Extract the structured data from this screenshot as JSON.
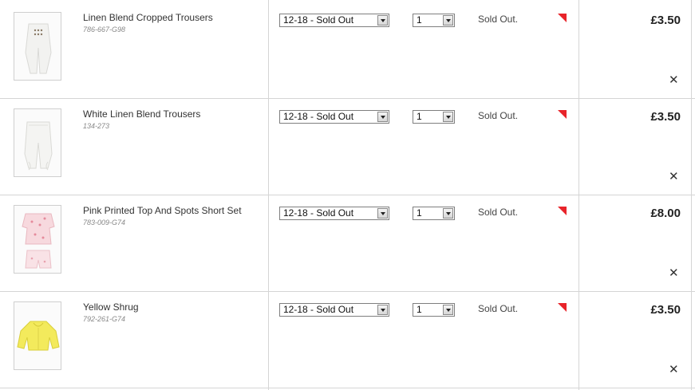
{
  "basket": {
    "items": [
      {
        "title": "Linen Blend Cropped Trousers",
        "sku": "786-667-G98",
        "size": "12-18 - Sold Out",
        "qty": "1",
        "status": "Sold Out.",
        "price": "£3.50",
        "image_icon": "white-cropped-trousers-image"
      },
      {
        "title": "White Linen Blend Trousers",
        "sku": "134-273",
        "size": "12-18 - Sold Out",
        "qty": "1",
        "status": "Sold Out.",
        "price": "£3.50",
        "image_icon": "white-trousers-image"
      },
      {
        "title": "Pink Printed Top And Spots Short Set",
        "sku": "783-009-G74",
        "size": "12-18 - Sold Out",
        "qty": "1",
        "status": "Sold Out.",
        "price": "£8.00",
        "image_icon": "pink-short-set-image"
      },
      {
        "title": "Yellow Shrug",
        "sku": "792-261-G74",
        "size": "12-18 - Sold Out",
        "qty": "1",
        "status": "Sold Out.",
        "price": "£3.50",
        "image_icon": "yellow-shrug-image"
      }
    ],
    "remove_glyph": "✕",
    "colors": {
      "flag": "#e8242a",
      "border": "#d5d5d5"
    }
  }
}
